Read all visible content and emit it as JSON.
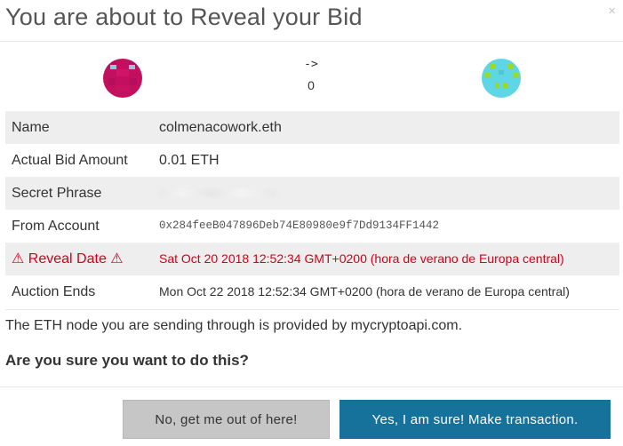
{
  "modal": {
    "title": "You are about to Reveal your Bid",
    "close_glyph": "×"
  },
  "transfer": {
    "arrow": "->",
    "amount": "0",
    "from_identicon": "identicon-magenta",
    "to_identicon": "identicon-cyan"
  },
  "details": {
    "name": {
      "label": "Name",
      "value": "colmenacowork.eth"
    },
    "bid": {
      "label": "Actual Bid Amount",
      "value": "0.01 ETH"
    },
    "secret": {
      "label": "Secret Phrase",
      "value": ""
    },
    "from": {
      "label": "From Account",
      "value": "0x284feeB047896Deb74E80980e9f7Dd9134FF1442"
    },
    "reveal": {
      "label": "⚠ Reveal Date ⚠",
      "value": "Sat Oct 20 2018 12:52:34 GMT+0200 (hora de verano de Europa central)"
    },
    "ends": {
      "label": "Auction Ends",
      "value": "Mon Oct 22 2018 12:52:34 GMT+0200 (hora de verano de Europa central)"
    }
  },
  "footer": {
    "node_info": "The ETH node you are sending through is provided by mycryptoapi.com.",
    "question": "Are you sure you want to do this?",
    "cancel_label": "No, get me out of here!",
    "confirm_label": "Yes, I am sure! Make transaction."
  },
  "colors": {
    "warning": "#d0021b",
    "primary_button": "#16719b",
    "secondary_button": "#c6c6c6",
    "row_shade": "#eeeeee"
  }
}
